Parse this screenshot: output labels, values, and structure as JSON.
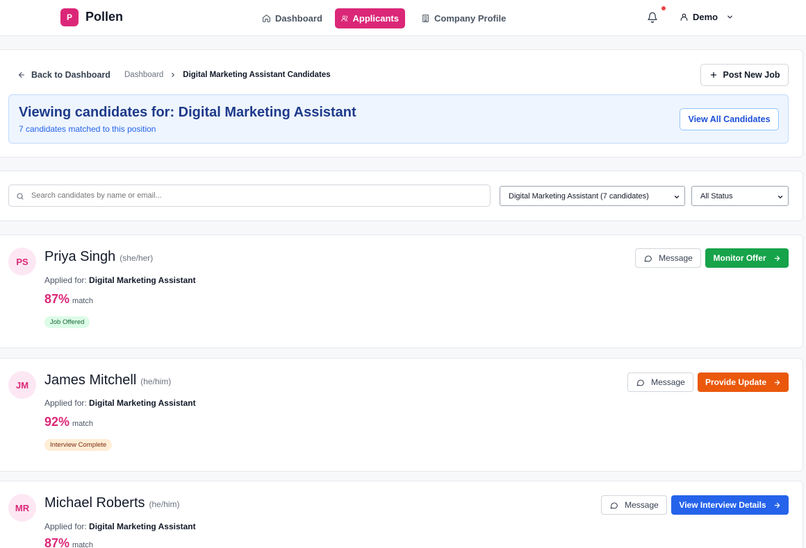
{
  "app": {
    "logo_letter": "P",
    "name": "Pollen"
  },
  "nav": {
    "tabs": [
      {
        "label": "Dashboard",
        "icon": "home-icon"
      },
      {
        "label": "Applicants",
        "icon": "users-icon",
        "active": true
      },
      {
        "label": "Company Profile",
        "icon": "building-icon"
      }
    ],
    "user": "Demo"
  },
  "header": {
    "back_label": "Back to Dashboard",
    "breadcrumb": [
      "Dashboard",
      "Digital Marketing Assistant Candidates"
    ],
    "post_job_label": "Post New Job",
    "banner_title": "Viewing candidates for: Digital Marketing Assistant",
    "banner_subtitle": "7 candidates matched to this position",
    "view_all_label": "View All Candidates"
  },
  "filters": {
    "search_placeholder": "Search candidates by name or email...",
    "job_select": "Digital Marketing Assistant (7 candidates)",
    "status_select": "All Status"
  },
  "candidates": [
    {
      "initials": "PS",
      "name": "Priya Singh",
      "pronouns": "(she/her)",
      "applied_prefix": "Applied for:",
      "applied_job": "Digital Marketing Assistant",
      "match": "87%",
      "match_label": "match",
      "status": "Job Offered",
      "status_color": "#dcfce7",
      "message_label": "Message",
      "action_label": "Monitor Offer",
      "action_color": "#16a34a"
    },
    {
      "initials": "JM",
      "name": "James Mitchell",
      "pronouns": "(he/him)",
      "applied_prefix": "Applied for:",
      "applied_job": "Digital Marketing Assistant",
      "match": "92%",
      "match_label": "match",
      "status": "Interview Complete",
      "status_color": "#ffedd5",
      "message_label": "Message",
      "action_label": "Provide Update",
      "action_color": "#ea580c"
    },
    {
      "initials": "MR",
      "name": "Michael Roberts",
      "pronouns": "(he/him)",
      "applied_prefix": "Applied for:",
      "applied_job": "Digital Marketing Assistant",
      "match": "87%",
      "match_label": "match",
      "message_label": "Message",
      "action_label": "View Interview Details",
      "action_color": "#2563eb"
    }
  ],
  "colors": {
    "brand": "#db2777",
    "banner_bg": "#eef5fe",
    "banner_text": "#1e3a8a"
  }
}
